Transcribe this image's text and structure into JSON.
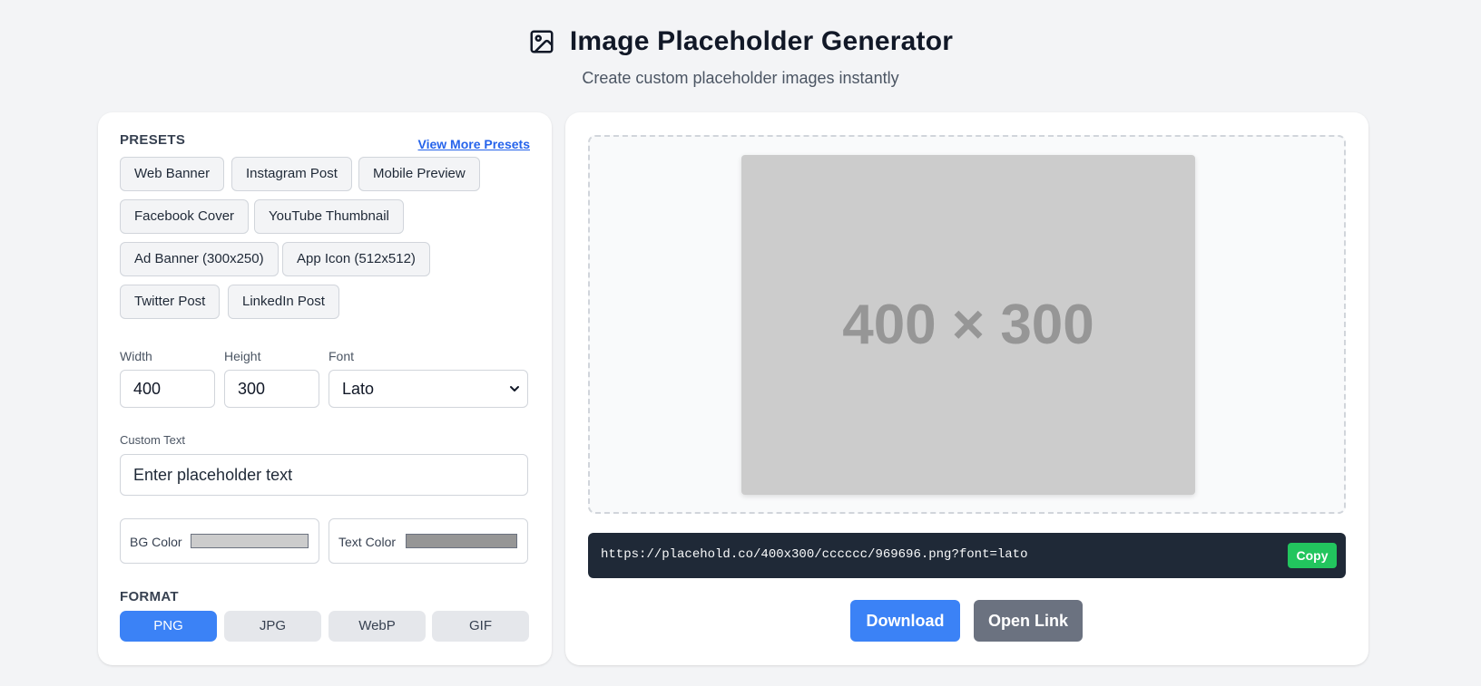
{
  "header": {
    "title": "Image Placeholder Generator",
    "subtitle": "Create custom placeholder images instantly",
    "icon": "image-icon"
  },
  "presets": {
    "label": "PRESETS",
    "view_more": "View More Presets",
    "items": [
      "Web Banner",
      "Instagram Post",
      "Mobile Preview",
      "Facebook Cover",
      "YouTube Thumbnail",
      "Ad Banner (300x250)",
      "App Icon (512x512)",
      "Twitter Post",
      "LinkedIn Post"
    ]
  },
  "fields": {
    "width_label": "Width",
    "width_value": "400",
    "height_label": "Height",
    "height_value": "300",
    "font_label": "Font",
    "font_value": "Lato",
    "custom_text_label": "Custom Text",
    "custom_text_placeholder": "Enter placeholder text",
    "bg_color_label": "BG Color",
    "bg_color": "#cccccc",
    "text_color_label": "Text Color",
    "text_color": "#969696"
  },
  "format": {
    "label": "FORMAT",
    "options": [
      "PNG",
      "JPG",
      "WebP",
      "GIF"
    ],
    "selected": "PNG"
  },
  "preview": {
    "image_text": "400 × 300",
    "url": "https://placehold.co/400x300/cccccc/969696.png?font=lato",
    "copy_label": "Copy",
    "download_label": "Download",
    "open_link_label": "Open Link"
  },
  "colors": {
    "accent": "#3b82f6",
    "link": "#2563eb",
    "copy": "#22c55e",
    "url_bar": "#1f2937",
    "secondary": "#6b7280"
  }
}
